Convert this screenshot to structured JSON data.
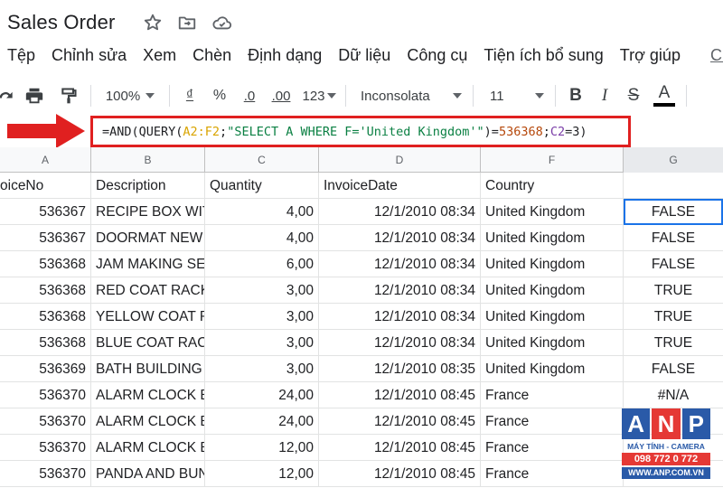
{
  "title": {
    "doc_name": "Sales Order",
    "star_icon": "star-icon",
    "move_icon": "folder-move-icon",
    "cloud_icon": "cloud-saved-icon"
  },
  "menu": [
    "Tệp",
    "Chỉnh sửa",
    "Xem",
    "Chèn",
    "Định dạng",
    "Dữ liệu",
    "Công cụ",
    "Tiện ích bổ sung",
    "Trợ giúp"
  ],
  "menu_link": "Chỉnh",
  "toolbar": {
    "zoom": "100%",
    "currency": "₫",
    "percent": "%",
    "decrease_decimals": ".0",
    "increase_decimals": ".00",
    "more_formats": "123",
    "font": "Inconsolata",
    "font_size": "11",
    "bold": "B",
    "italic": "I",
    "strike": "S",
    "text_color": "A"
  },
  "formula": {
    "p1": "=AND(QUERY(",
    "range": "A2:F2",
    "p2": ";",
    "query": "\"SELECT A WHERE F='United Kingdom'\"",
    "p3": ")=",
    "num": "536368",
    "p4": ";",
    "ref": "C2",
    "p5": "=3)"
  },
  "columns": [
    "A",
    "B",
    "C",
    "D",
    "F",
    "G"
  ],
  "headers": {
    "a": "oiceNo",
    "b": "Description",
    "c": "Quantity",
    "d": "InvoiceDate",
    "f": "Country",
    "g": ""
  },
  "rows": [
    {
      "a": "536367",
      "b": "RECIPE BOX WIT",
      "c": "4,00",
      "d": "12/1/2010 08:34",
      "f": "United Kingdom",
      "g": "FALSE"
    },
    {
      "a": "536367",
      "b": "DOORMAT NEW",
      "c": "4,00",
      "d": "12/1/2010 08:34",
      "f": "United Kingdom",
      "g": "FALSE"
    },
    {
      "a": "536368",
      "b": "JAM MAKING SE",
      "c": "6,00",
      "d": "12/1/2010 08:34",
      "f": "United Kingdom",
      "g": "FALSE"
    },
    {
      "a": "536368",
      "b": "RED COAT RACK",
      "c": "3,00",
      "d": "12/1/2010 08:34",
      "f": "United Kingdom",
      "g": "TRUE"
    },
    {
      "a": "536368",
      "b": "YELLOW COAT RA",
      "c": "3,00",
      "d": "12/1/2010 08:34",
      "f": "United Kingdom",
      "g": "TRUE"
    },
    {
      "a": "536368",
      "b": "BLUE COAT RACK",
      "c": "3,00",
      "d": "12/1/2010 08:34",
      "f": "United Kingdom",
      "g": "TRUE"
    },
    {
      "a": "536369",
      "b": "BATH BUILDING",
      "c": "3,00",
      "d": "12/1/2010 08:35",
      "f": "United Kingdom",
      "g": "FALSE"
    },
    {
      "a": "536370",
      "b": "ALARM CLOCK B",
      "c": "24,00",
      "d": "12/1/2010 08:45",
      "f": "France",
      "g": "#N/A"
    },
    {
      "a": "536370",
      "b": "ALARM CLOCK B",
      "c": "24,00",
      "d": "12/1/2010 08:45",
      "f": "France",
      "g": ""
    },
    {
      "a": "536370",
      "b": "ALARM CLOCK B",
      "c": "12,00",
      "d": "12/1/2010 08:45",
      "f": "France",
      "g": ""
    },
    {
      "a": "536370",
      "b": "PANDA AND BUN",
      "c": "12,00",
      "d": "12/1/2010 08:45",
      "f": "France",
      "g": ""
    }
  ],
  "watermark": {
    "brand": [
      "A",
      "N",
      "P"
    ],
    "line1": "MÁY TÍNH - CAMERA",
    "line2": "098 772 0 772",
    "line3": "WWW.ANP.COM.VN"
  },
  "colors": {
    "accent": "#1a73e8",
    "highlight_border": "#e02020",
    "wm_a": "#2a5aa8",
    "wm_n": "#e53935",
    "wm_p": "#2a5aa8"
  }
}
